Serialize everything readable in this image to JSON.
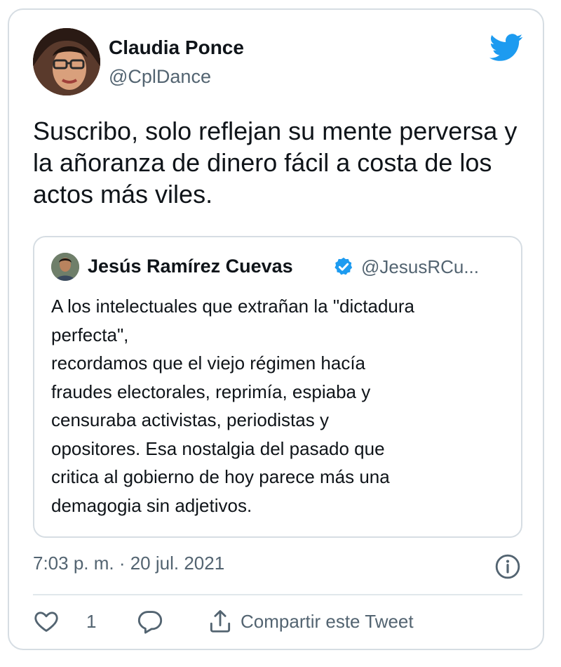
{
  "author": {
    "name": "Claudia Ponce",
    "handle": "@CplDance"
  },
  "tweet": {
    "text": "Suscribo, solo reflejan su mente perversa y la añoranza de dinero fácil a costa de los actos más viles."
  },
  "quoted_tweet": {
    "author_name": "Jesús Ramírez Cuevas",
    "author_handle": "@JesusRCu...",
    "verified": true,
    "lines": [
      "A los intelectuales que extrañan la \"dictadura",
      "perfecta\",",
      "recordamos que el viejo régimen hacía",
      "fraudes electorales, reprimía, espiaba y",
      "censuraba activistas, periodistas y",
      "opositores. Esa nostalgia del pasado que",
      "critica al gobierno de hoy parece más una",
      "demagogia sin adjetivos."
    ]
  },
  "meta": {
    "timestamp": "7:03 p. m. · 20 jul. 2021"
  },
  "actions": {
    "like_count": "1",
    "share_label": "Compartir este Tweet"
  },
  "icons": {
    "brand": "twitter-bird-icon",
    "verified": "verified-badge-icon",
    "info": "info-icon",
    "like": "heart-icon",
    "reply": "reply-bubble-icon",
    "share": "share-icon"
  },
  "colors": {
    "brand_blue": "#1d9bf0",
    "text_primary": "#0f1419",
    "text_secondary": "#536471",
    "border": "#d6dde3"
  }
}
